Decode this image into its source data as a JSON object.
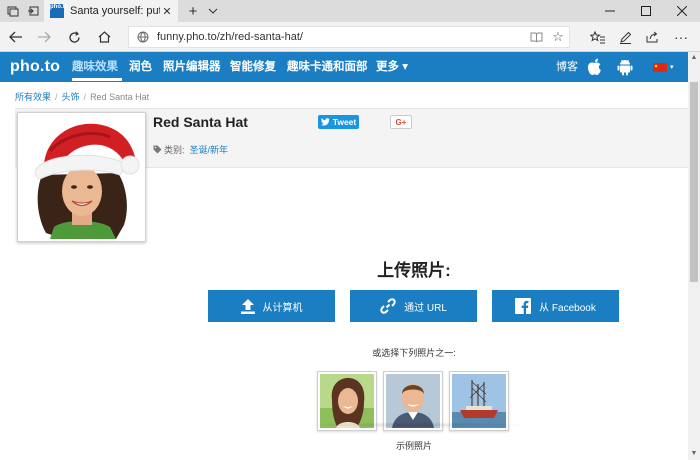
{
  "browser": {
    "tab_title": "Santa yourself: put a Sa",
    "favicon_text": "pho.to",
    "url": "funny.pho.to/zh/red-santa-hat/"
  },
  "site": {
    "logo": "pho.to",
    "menu": [
      "趣味效果",
      "润色",
      "照片编辑器",
      "智能修复",
      "趣味卡通和面部",
      "更多 ▾"
    ],
    "blog_label": "博客"
  },
  "breadcrumb": [
    "所有效果",
    "头饰",
    "Red Santa Hat"
  ],
  "effect": {
    "title": "Red Santa Hat",
    "tweet_label": "Tweet",
    "gplus_label": "G+",
    "category_label": "类别:",
    "category_value": "圣诞/新年"
  },
  "upload": {
    "title": "上传照片:",
    "buttons": [
      "从计算机",
      "通过 URL",
      "从 Facebook"
    ],
    "choose_text": "或选择下列照片之一:",
    "sample_caption": "示例照片"
  },
  "colors": {
    "brand_blue": "#1b7ec2",
    "twitter_blue": "#1b95e0",
    "gplus_red": "#dd4b39"
  }
}
